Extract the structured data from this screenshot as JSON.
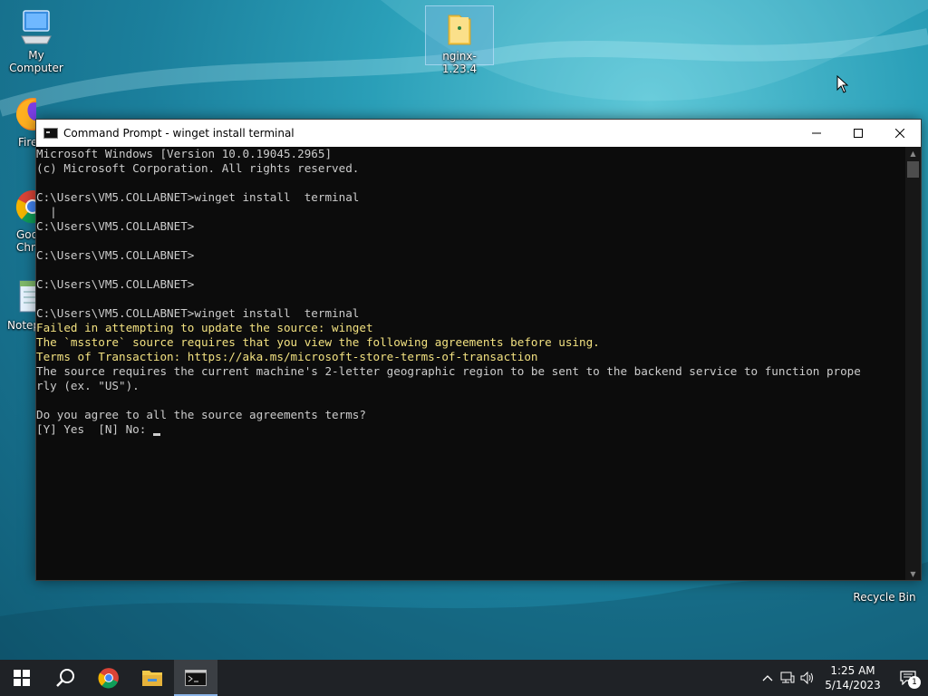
{
  "desktop": {
    "icons": [
      {
        "label": "My Computer"
      },
      {
        "label": "Fire"
      },
      {
        "label": "Goo\nChr"
      },
      {
        "label": "Notep"
      },
      {
        "label": "nginx-1.23.4"
      },
      {
        "label": "Recycle Bin"
      }
    ]
  },
  "window": {
    "title": "Command Prompt - winget  install  terminal",
    "minimize": "—",
    "maximize": "☐",
    "close": "✕"
  },
  "console": {
    "lines": [
      {
        "text": "Microsoft Windows [Version 10.0.19045.2965]",
        "color": "default"
      },
      {
        "text": "(c) Microsoft Corporation. All rights reserved.",
        "color": "default"
      },
      {
        "text": "",
        "color": "default"
      },
      {
        "text": "C:\\Users\\VM5.COLLABNET>winget install  terminal",
        "color": "default"
      },
      {
        "text": "  |",
        "color": "default"
      },
      {
        "text": "C:\\Users\\VM5.COLLABNET>",
        "color": "default"
      },
      {
        "text": "",
        "color": "default"
      },
      {
        "text": "C:\\Users\\VM5.COLLABNET>",
        "color": "default"
      },
      {
        "text": "",
        "color": "default"
      },
      {
        "text": "C:\\Users\\VM5.COLLABNET>",
        "color": "default"
      },
      {
        "text": "",
        "color": "default"
      },
      {
        "text": "C:\\Users\\VM5.COLLABNET>winget install  terminal",
        "color": "default"
      },
      {
        "text": "Failed in attempting to update the source: winget",
        "color": "yellow"
      },
      {
        "text": "The `msstore` source requires that you view the following agreements before using.",
        "color": "yellow"
      },
      {
        "text": "Terms of Transaction: https://aka.ms/microsoft-store-terms-of-transaction",
        "color": "yellow"
      },
      {
        "text": "The source requires the current machine's 2-letter geographic region to be sent to the backend service to function prope",
        "color": "default"
      },
      {
        "text": "rly (ex. \"US\").",
        "color": "default"
      },
      {
        "text": "",
        "color": "default"
      },
      {
        "text": "Do you agree to all the source agreements terms?",
        "color": "default"
      },
      {
        "text": "[Y] Yes  [N] No: ",
        "color": "default"
      }
    ]
  },
  "taskbar": {
    "clock_time": "1:25 AM",
    "clock_date": "5/14/2023",
    "notification_count": "1"
  },
  "colors": {
    "console_bg": "#0c0c0c",
    "console_text": "#cccccc",
    "console_yellow": "#f2e180",
    "taskbar_bg": "#1f2226"
  }
}
